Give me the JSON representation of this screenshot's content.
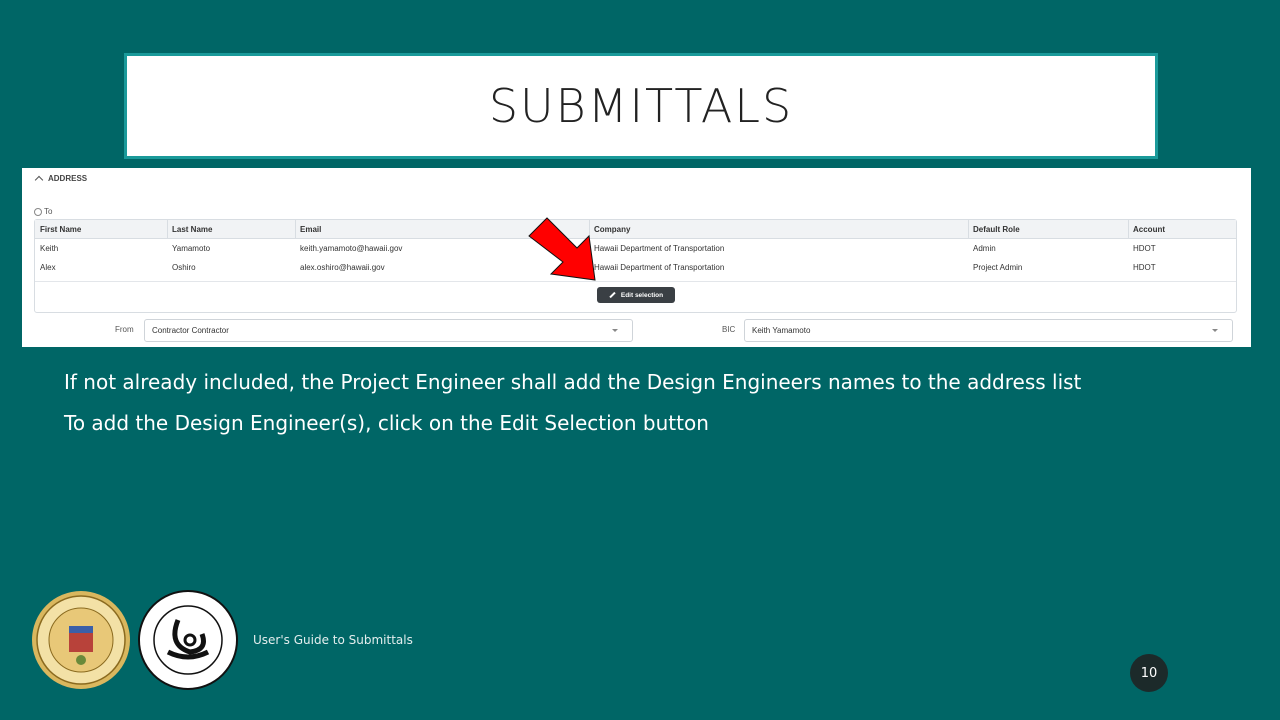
{
  "slide": {
    "title": "SUBMITTALS",
    "bullets": [
      "If not already included, the Project Engineer shall add the Design Engineers names to the address list",
      "To add the Design Engineer(s), click on the Edit Selection button"
    ],
    "footer": "User's Guide to Submittals",
    "page_number": "10",
    "logos": [
      {
        "name": "state-of-hawaii-seal",
        "text": "STATE OF HAWAII 1959"
      },
      {
        "name": "dept-of-transportation-logo",
        "text": "DEPARTMENT OF TRANSPORTATION STATE OF HAWAII"
      }
    ]
  },
  "screenshot": {
    "section_title": "ADDRESS",
    "to_label": "To",
    "columns": [
      "First Name",
      "Last Name",
      "Email",
      "Company",
      "Default Role",
      "Account"
    ],
    "rows": [
      [
        "Keith",
        "Yamamoto",
        "keith.yamamoto@hawaii.gov",
        "Hawaii Department of Transportation",
        "Admin",
        "HDOT"
      ],
      [
        "Alex",
        "Oshiro",
        "alex.oshiro@hawaii.gov",
        "Hawaii Department of Transportation",
        "Project Admin",
        "HDOT"
      ]
    ],
    "edit_button": "Edit selection",
    "from_label": "From",
    "from_value": "Contractor Contractor",
    "bic_label": "BIC",
    "bic_value": "Keith Yamamoto"
  },
  "colors": {
    "background": "#006666",
    "title_border": "#1a9a9a",
    "arrow": "#ff0000",
    "button": "#3a3f44"
  }
}
